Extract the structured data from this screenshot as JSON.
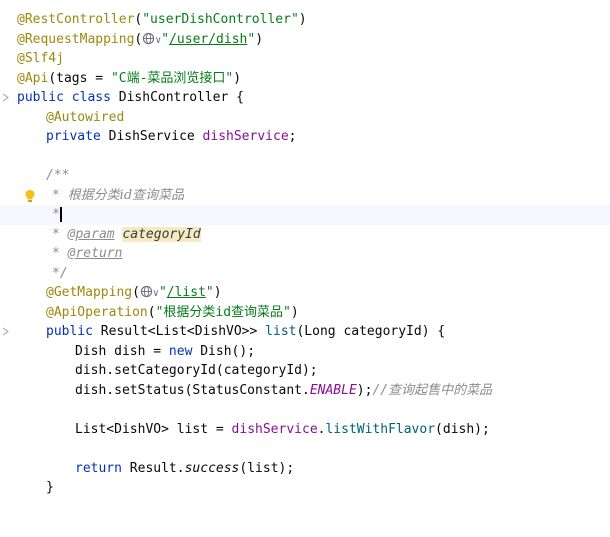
{
  "code": {
    "l1": {
      "ann": "@RestController",
      "open": "(",
      "str": "\"userDishController\"",
      "close": ")"
    },
    "l2": {
      "ann": "@RequestMapping",
      "open": "(",
      "globe": "globe-icon",
      "chev": "∨",
      "str_q": "\"",
      "str_path": "/user/dish",
      "str_q2": "\"",
      "close": ")"
    },
    "l3": {
      "ann": "@Slf4j"
    },
    "l4": {
      "ann": "@Api",
      "rest": "(tags = ",
      "str": "\"C端-菜品浏览接口\"",
      "close": ")"
    },
    "l5": {
      "kw1": "public",
      "kw2": "class",
      "name": "DishController {"
    },
    "l6": {
      "ann": "@Autowired"
    },
    "l7": {
      "kw": "private",
      "type": "DishService",
      "fld": "dishService",
      "end": ";"
    },
    "l8": {
      "doc": "/**"
    },
    "l9": {
      "star": "*",
      "text": "根据分类id查询菜品"
    },
    "l10": {
      "star": "*"
    },
    "l11": {
      "star": "*",
      "tag": "@param",
      "param": "categoryId"
    },
    "l12": {
      "star": "*",
      "tag": "@return"
    },
    "l13": {
      "doc": "*/"
    },
    "l14": {
      "ann": "@GetMapping",
      "open": "(",
      "chev": "∨",
      "str_q": "\"",
      "str_path": "/list",
      "str_q2": "\"",
      "close": ")"
    },
    "l15": {
      "ann": "@ApiOperation",
      "open": "(",
      "str": "\"根据分类id查询菜品\"",
      "close": ")"
    },
    "l16": {
      "kw": "public",
      "sig1": "Result<List<DishVO>>",
      "method": "list",
      "sig2": "(Long categoryId) {"
    },
    "l17": {
      "p1": "Dish dish = ",
      "kw": "new",
      "p2": "Dish();"
    },
    "l18": {
      "text": "dish.setCategoryId(categoryId);"
    },
    "l19": {
      "p1": "dish.setStatus(StatusConstant.",
      "const": "ENABLE",
      "p2": ");",
      "comment": "//查询起售中的菜品"
    },
    "l20": {
      "p1": "List<DishVO> list = ",
      "fld": "dishService",
      "dot": ".",
      "method": "listWithFlavor",
      "p2": "(dish);"
    },
    "l21": {
      "kw": "return",
      "p1": "Result.",
      "static": "success",
      "p2": "(list);"
    },
    "l22": {
      "text": "}"
    }
  },
  "icons": {
    "bulb": "lightbulb-icon",
    "fold": "fold-arrow-icon"
  },
  "colors": {
    "annotation": "#9e880d",
    "string": "#067d17",
    "keyword": "#0033b3",
    "field": "#871094",
    "method": "#00627a",
    "comment": "#8c8c8c"
  }
}
